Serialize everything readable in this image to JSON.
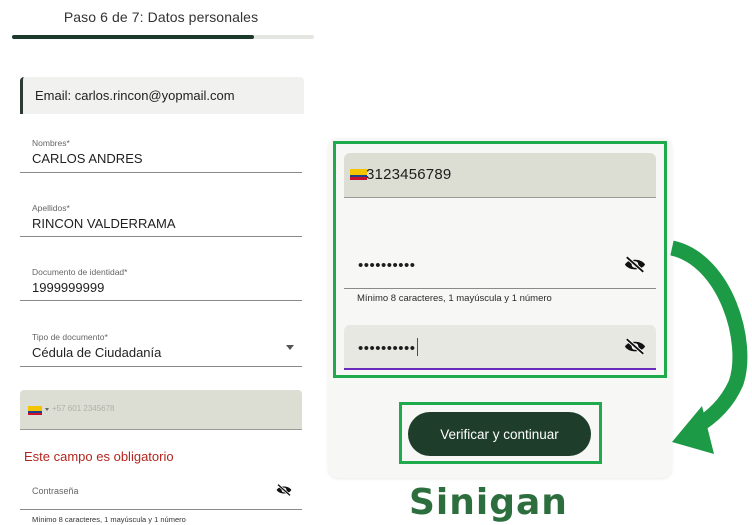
{
  "header": {
    "step_title": "Paso 6 de 7: Datos personales",
    "progress": 0.8
  },
  "form_left": {
    "email": "Email: carlos.rincon@yopmail.com",
    "fields": [
      {
        "label": "Nombres*",
        "value": "CARLOS ANDRES"
      },
      {
        "label": "Apellidos*",
        "value": "RINCON VALDERRAMA"
      },
      {
        "label": "Documento de identidad*",
        "value": "1999999999"
      },
      {
        "label": "Tipo de documento*",
        "value": "Cédula de Ciudadanía"
      }
    ],
    "phone_placeholder": "+57 601 2345678",
    "error": "Este campo es obligatorio",
    "password_label": "Contraseña",
    "password_hint": "Mínimo 8 caracteres, 1 mayúscula y 1 número"
  },
  "form_zoom": {
    "phone_value": "3123456789",
    "password_masked": "••••••••••",
    "password_hint": "Mínimo 8 caracteres, 1 mayúscula y 1 número",
    "confirm_masked": "••••••••••",
    "verify_button": "Verificar y continuar"
  },
  "logo": {
    "text": "Sinigan"
  },
  "icons": {
    "eye": "eye-off-icon",
    "flag": "colombia-flag-icon",
    "dropdown": "chevron-down-icon",
    "arrow": "curved-arrow-icon"
  },
  "colors": {
    "primary": "#1e3e2b",
    "highlight": "#1faa4d",
    "error": "#b3261e",
    "focus": "#6a2bbd",
    "logo": "#2d6e3e"
  }
}
